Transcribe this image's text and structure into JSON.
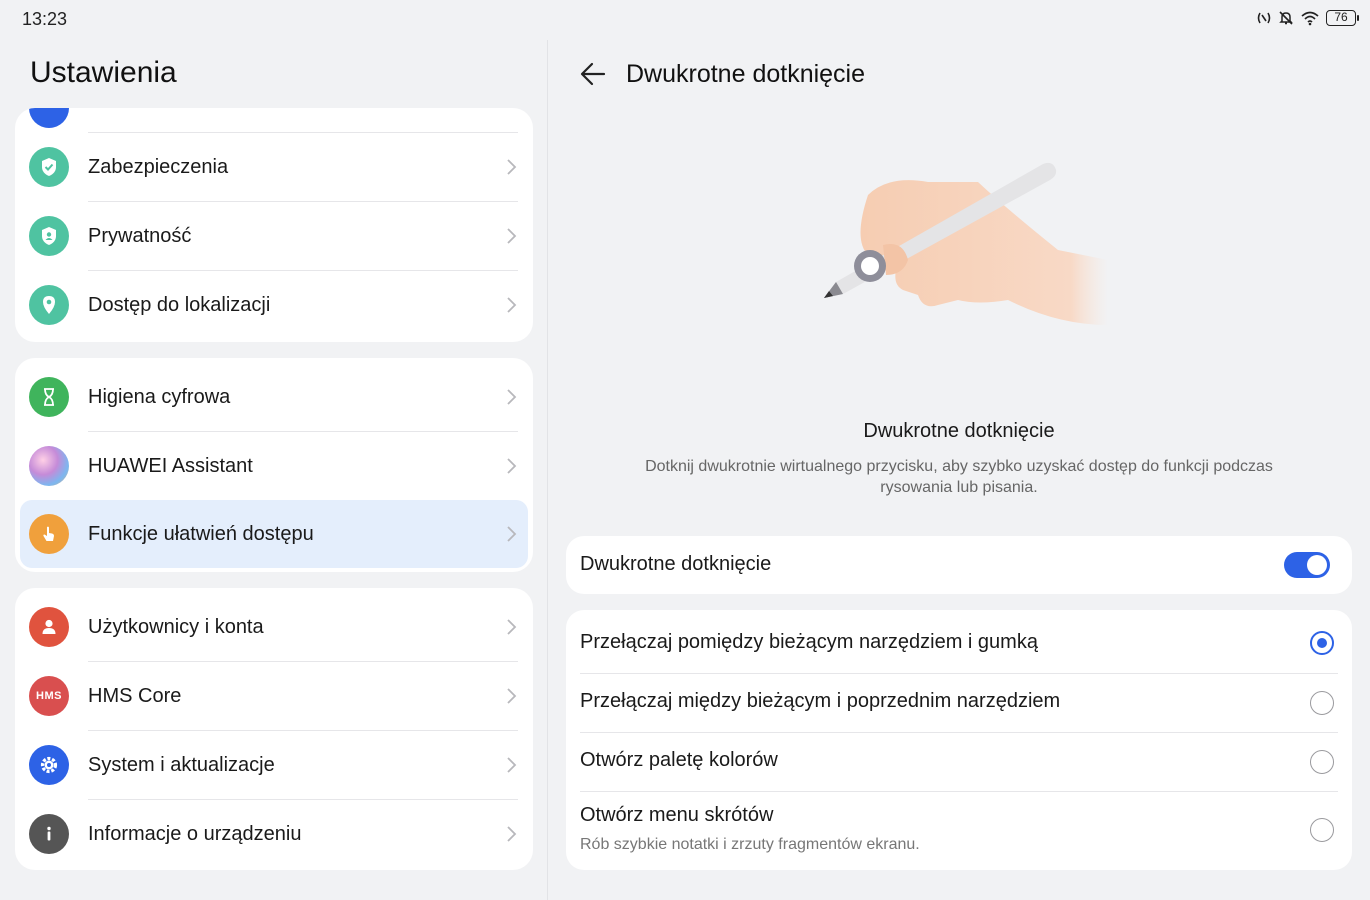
{
  "status": {
    "time": "13:23",
    "battery": "76"
  },
  "left": {
    "title": "Ustawienia",
    "group1": [
      {
        "label": "Zabezpieczenia",
        "icon": "shield-check-icon",
        "color": "#4fc3a1"
      },
      {
        "label": "Prywatność",
        "icon": "privacy-icon",
        "color": "#4fc3a1"
      },
      {
        "label": "Dostęp do lokalizacji",
        "icon": "location-pin-icon",
        "color": "#4fc3a1"
      }
    ],
    "group2": [
      {
        "label": "Higiena cyfrowa",
        "icon": "hourglass-icon",
        "color": "#3fb45c"
      },
      {
        "label": "HUAWEI Assistant",
        "icon": "huawei-assistant-icon",
        "color": "#c58bd8"
      },
      {
        "label": "Funkcje ułatwień dostępu",
        "icon": "accessibility-hand-icon",
        "color": "#f0a03c",
        "active": true
      }
    ],
    "group3": [
      {
        "label": "Użytkownicy i konta",
        "icon": "user-icon",
        "color": "#e0533e"
      },
      {
        "label": "HMS Core",
        "icon": "hms-core-icon",
        "color": "#d94f4f",
        "badge": "HMS"
      },
      {
        "label": "System i aktualizacje",
        "icon": "gear-icon",
        "color": "#2d62e6"
      },
      {
        "label": "Informacje o urządzeniu",
        "icon": "info-icon",
        "color": "#555555"
      }
    ]
  },
  "right": {
    "title": "Dwukrotne dotknięcie",
    "section_heading": "Dwukrotne dotknięcie",
    "section_desc": "Dotknij dwukrotnie wirtualnego przycisku, aby szybko uzyskać dostęp do funkcji podczas rysowania lub pisania.",
    "toggle_label": "Dwukrotne dotknięcie",
    "toggle_on": true,
    "options": [
      {
        "label": "Przełączaj pomiędzy bieżącym narzędziem i gumką",
        "selected": true
      },
      {
        "label": "Przełączaj między bieżącym i poprzednim narzędziem",
        "selected": false
      },
      {
        "label": "Otwórz paletę kolorów",
        "selected": false
      },
      {
        "label": "Otwórz menu skrótów",
        "sub": "Rób szybkie notatki i zrzuty fragmentów ekranu.",
        "selected": false
      }
    ]
  },
  "colors": {
    "accent": "#2d62e6",
    "active_row": "#e4eefc",
    "background": "#f1f2f4"
  }
}
